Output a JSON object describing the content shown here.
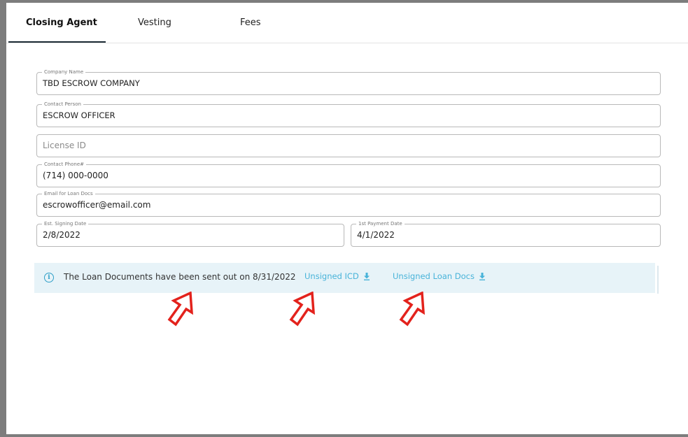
{
  "tabs": [
    {
      "label": "Closing Agent",
      "active": true
    },
    {
      "label": "Vesting",
      "active": false
    },
    {
      "label": "Fees",
      "active": false
    }
  ],
  "form": {
    "company_name": {
      "label": "Company Name",
      "value": "TBD ESCROW COMPANY"
    },
    "contact_person": {
      "label": "Contact Person",
      "value": "ESCROW OFFICER"
    },
    "license_id": {
      "placeholder": "License ID",
      "value": ""
    },
    "contact_phone": {
      "label": "Contact Phone#",
      "value": "(714) 000-0000"
    },
    "email_loan_docs": {
      "label": "Email for Loan Docs",
      "value": "escrowofficer@email.com"
    },
    "est_signing_date": {
      "label": "Est. Signing Date",
      "value": "2/8/2022"
    },
    "first_payment_date": {
      "label": "1st Payment Date",
      "value": "4/1/2022"
    }
  },
  "alert": {
    "icon": "info-icon",
    "message": "The Loan Documents have been sent out on 8/31/2022",
    "links": [
      {
        "label": "Unsigned ICD",
        "icon": "download-icon"
      },
      {
        "label": "Unsigned Loan Docs",
        "icon": "download-icon"
      }
    ]
  },
  "annotations": {
    "arrow_color": "#e3221c",
    "count": 3
  },
  "colors": {
    "accent": "#48b3d9",
    "alert_bg": "#e7f3f8",
    "tab_indicator": "#1d2b36"
  }
}
